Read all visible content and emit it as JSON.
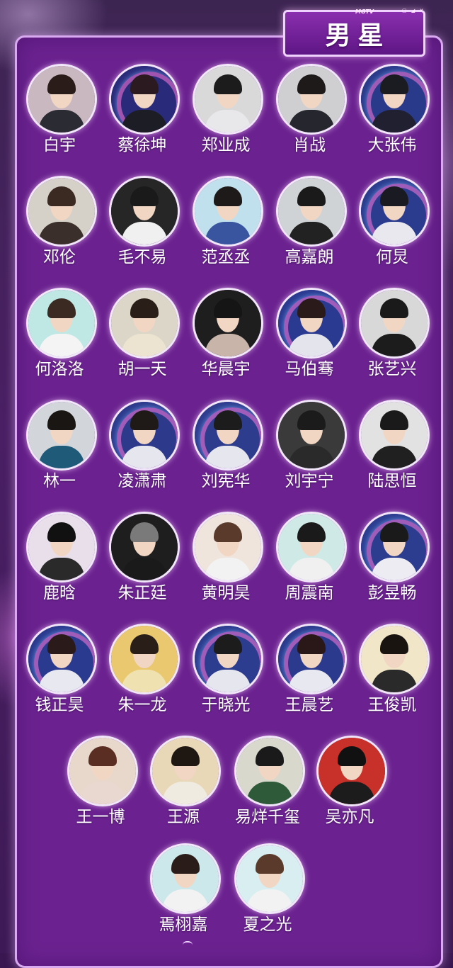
{
  "title": "男星",
  "brand": "MGTV",
  "window_icons": "▢ ◢ ✕",
  "people": [
    {
      "name": "白宇",
      "bg": "#c9b8c0",
      "hair": "#2a1c18",
      "shirt": "#2b2b33",
      "ring": false
    },
    {
      "name": "蔡徐坤",
      "bg": "#2a2a7a",
      "hair": "#2b1a20",
      "shirt": "#1d1d26",
      "ring": true
    },
    {
      "name": "郑业成",
      "bg": "#d9d9d9",
      "hair": "#1c1c1c",
      "shirt": "#e8e8ea",
      "ring": false
    },
    {
      "name": "肖战",
      "bg": "#cfcfd2",
      "hair": "#1e1a1a",
      "shirt": "#26262e",
      "ring": false
    },
    {
      "name": "大张伟",
      "bg": "#2a3a8a",
      "hair": "#1b1b22",
      "shirt": "#202030",
      "ring": true
    },
    {
      "name": "邓伦",
      "bg": "#d5d0c8",
      "hair": "#3a2a22",
      "shirt": "#3a2f2a",
      "ring": false
    },
    {
      "name": "毛不易",
      "bg": "#262626",
      "hair": "#1a1a1a",
      "shirt": "#f0f0f0",
      "ring": false
    },
    {
      "name": "范丞丞",
      "bg": "#bfe0ec",
      "hair": "#1f1a1a",
      "shirt": "#3a55a0",
      "ring": false
    },
    {
      "name": "高嘉朗",
      "bg": "#cfd3d6",
      "hair": "#1a1a1a",
      "shirt": "#222222",
      "ring": false
    },
    {
      "name": "何炅",
      "bg": "#2b3c8e",
      "hair": "#1a1a22",
      "shirt": "#e8e8ee",
      "ring": true
    },
    {
      "name": "何洛洛",
      "bg": "#bfe8e4",
      "hair": "#3a2a22",
      "shirt": "#f4f4f4",
      "ring": false
    },
    {
      "name": "胡一天",
      "bg": "#dcd6c8",
      "hair": "#2a1f18",
      "shirt": "#ece3d0",
      "ring": false
    },
    {
      "name": "华晨宇",
      "bg": "#1e1e1e",
      "hair": "#151515",
      "shirt": "#c8b4a8",
      "ring": false
    },
    {
      "name": "马伯骞",
      "bg": "#2a3a90",
      "hair": "#2a1a1a",
      "shirt": "#e4e4ec",
      "ring": true
    },
    {
      "name": "张艺兴",
      "bg": "#d8d8d8",
      "hair": "#1a1a1a",
      "shirt": "#1c1c1c",
      "ring": false
    },
    {
      "name": "林一",
      "bg": "#d2d6da",
      "hair": "#1a1614",
      "shirt": "#1f5a78",
      "ring": false
    },
    {
      "name": "凌潇肃",
      "bg": "#2d3a8c",
      "hair": "#1f1a18",
      "shirt": "#e6e6ee",
      "ring": true
    },
    {
      "name": "刘宪华",
      "bg": "#2e3c8e",
      "hair": "#1c1c1c",
      "shirt": "#e6e6ee",
      "ring": true
    },
    {
      "name": "刘宇宁",
      "bg": "#3a3a3a",
      "hair": "#1b1b1b",
      "shirt": "#2a2a2a",
      "ring": false
    },
    {
      "name": "陆思恒",
      "bg": "#e2e2e2",
      "hair": "#1a1a1a",
      "shirt": "#202020",
      "ring": false
    },
    {
      "name": "鹿晗",
      "bg": "#e9dfea",
      "hair": "#111111",
      "shirt": "#2a2a2a",
      "ring": false
    },
    {
      "name": "朱正廷",
      "bg": "#1e1e1e",
      "hair": "#7a7a7a",
      "shirt": "#1a1a1a",
      "ring": false
    },
    {
      "name": "黄明昊",
      "bg": "#efe5dc",
      "hair": "#5a3a2a",
      "shirt": "#f2f2f2",
      "ring": false
    },
    {
      "name": "周震南",
      "bg": "#cfeae6",
      "hair": "#1a1a1a",
      "shirt": "#f0f0f0",
      "ring": false
    },
    {
      "name": "彭昱畅",
      "bg": "#2c3d90",
      "hair": "#1a1a1a",
      "shirt": "#ececf2",
      "ring": true
    },
    {
      "name": "钱正昊",
      "bg": "#2a3a8e",
      "hair": "#2a1a1a",
      "shirt": "#e8e8f0",
      "ring": true
    },
    {
      "name": "朱一龙",
      "bg": "#e9c870",
      "hair": "#2a1f18",
      "shirt": "#f0e2b0",
      "ring": false
    },
    {
      "name": "于晓光",
      "bg": "#2c3c8e",
      "hair": "#1c1c1c",
      "shirt": "#e6e6ee",
      "ring": true
    },
    {
      "name": "王晨艺",
      "bg": "#2b3a8c",
      "hair": "#2a1818",
      "shirt": "#e8e8f0",
      "ring": true
    },
    {
      "name": "王俊凯",
      "bg": "#f2e6c8",
      "hair": "#1a1410",
      "shirt": "#2a2a2a",
      "ring": false
    },
    {
      "name": "王一博",
      "bg": "#e8d8cc",
      "hair": "#5a2e22",
      "shirt": "#e8d8d0",
      "ring": false
    },
    {
      "name": "王源",
      "bg": "#e8d8b8",
      "hair": "#1e1712",
      "shirt": "#f0ebe0",
      "ring": false
    },
    {
      "name": "易烊千玺",
      "bg": "#d8d8cc",
      "hair": "#1a1a1a",
      "shirt": "#2f5a3a",
      "ring": false
    },
    {
      "name": "吴亦凡",
      "bg": "#c8302a",
      "hair": "#111111",
      "shirt": "#1c1c1c",
      "ring": false
    },
    {
      "name": "焉栩嘉",
      "bg": "#cde8ea",
      "hair": "#2a1c18",
      "shirt": "#f2f2f2",
      "ring": false
    },
    {
      "name": "夏之光",
      "bg": "#d8eef0",
      "hair": "#5a3a2a",
      "shirt": "#f2f2f2",
      "ring": false
    }
  ]
}
